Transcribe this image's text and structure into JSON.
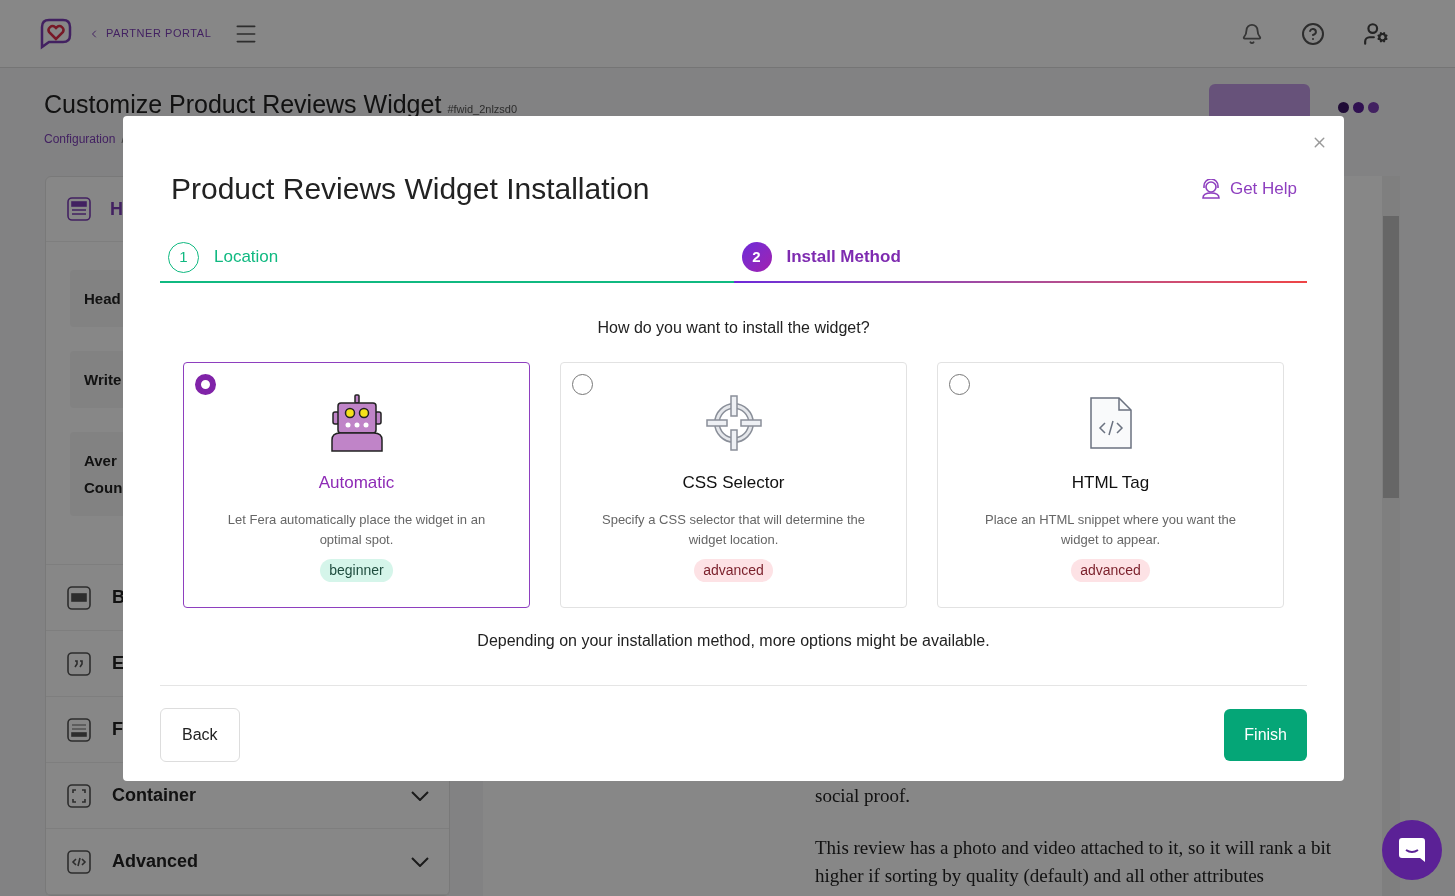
{
  "header": {
    "back_label": "PARTNER PORTAL"
  },
  "page": {
    "title": "Customize Product Reviews Widget",
    "widget_id": "#fwid_2nlzsd0",
    "breadcrumb": "Configuration",
    "breadcrumb_separator": "/"
  },
  "sidebar": {
    "section_title": "H",
    "fields": [
      {
        "label": "Head"
      },
      {
        "label": "Write"
      },
      {
        "label": "Aver\nCoun"
      }
    ],
    "sections": [
      {
        "label": "B"
      },
      {
        "label": "E"
      },
      {
        "label": "F"
      },
      {
        "label": "Container",
        "expandable": true
      },
      {
        "label": "Advanced",
        "expandable": true
      }
    ]
  },
  "preview": {
    "paragraphs": [
      "social proof.",
      "This review has a photo and video attached to it, so it will rank a bit higher if sorting by quality (default) and all other attributes"
    ]
  },
  "modal": {
    "title": "Product Reviews Widget Installation",
    "help_link": "Get Help",
    "steps": [
      {
        "number": "1",
        "label": "Location",
        "selected": false
      },
      {
        "number": "2",
        "label": "Install Method",
        "selected": true
      }
    ],
    "question": "How do you want to install the widget?",
    "options": [
      {
        "title": "Automatic",
        "description": "Let Fera automatically place the widget in an optimal spot.",
        "tag": "beginner",
        "color": "#d5f5ea",
        "selected": true
      },
      {
        "title": "CSS Selector",
        "description": "Specify a CSS selector that will determine the widget location.",
        "tag": "advanced",
        "color": "#fde2e5",
        "selected": false
      },
      {
        "title": "HTML Tag",
        "description": "Place an HTML snippet where you want the widget to appear.",
        "tag": "advanced",
        "color": "#fde2e5",
        "selected": false
      }
    ],
    "note": "Depending on your installation method, more options might be available.",
    "back_button": "Back",
    "finish_button": "Finish"
  }
}
